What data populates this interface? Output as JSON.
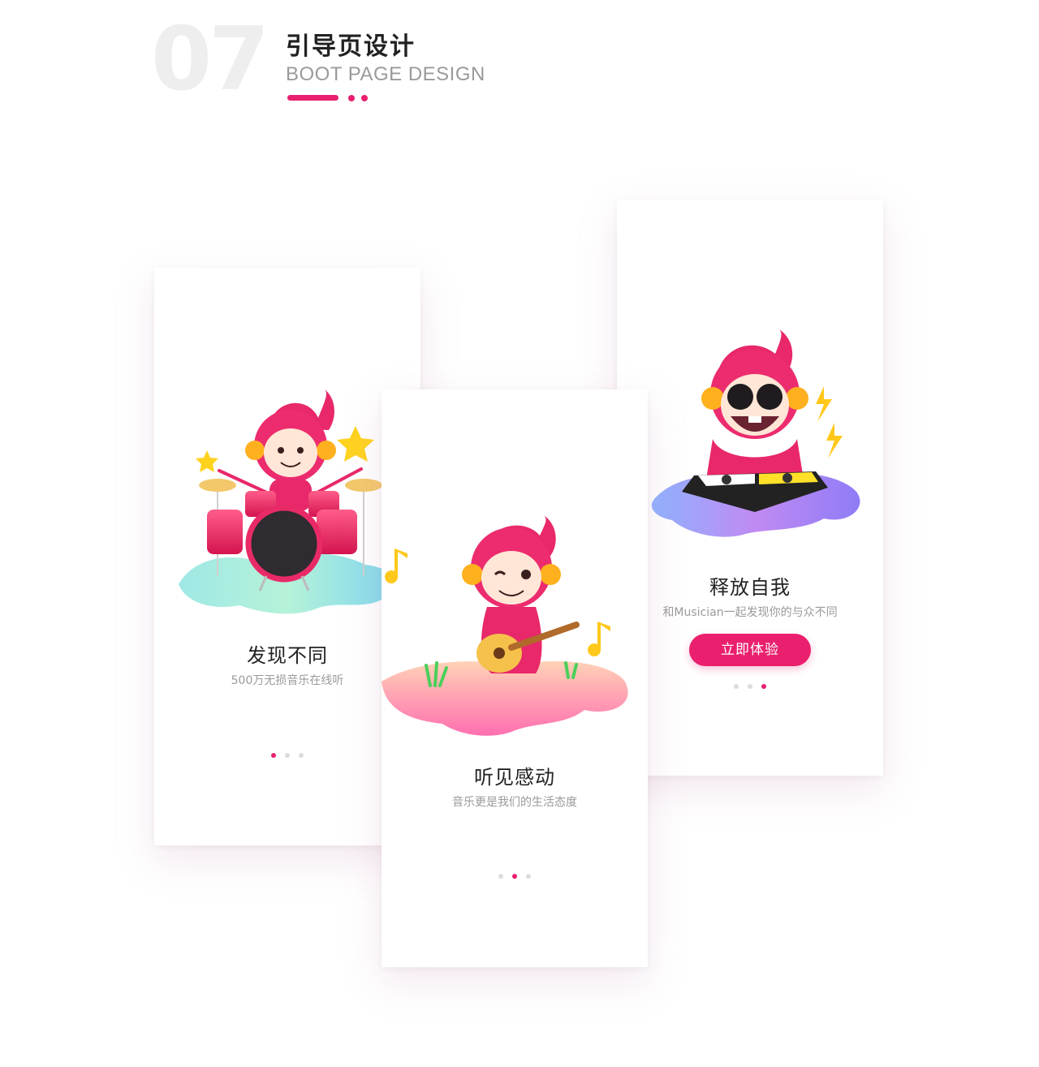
{
  "header": {
    "number": "07",
    "title_cn": "引导页设计",
    "title_en": "BOOT PAGE DESIGN",
    "accent_color": "#e8206f"
  },
  "screens": [
    {
      "title": "发现不同",
      "subtitle": "500万无损音乐在线听",
      "illustration": "drummer-mascot",
      "page_indicator": {
        "total": 3,
        "active": 1
      }
    },
    {
      "title": "听见感动",
      "subtitle": "音乐更是我们的生活态度",
      "illustration": "guitar-mascot",
      "page_indicator": {
        "total": 3,
        "active": 2
      }
    },
    {
      "title": "释放自我",
      "subtitle": "和Musician一起发现你的与众不同",
      "illustration": "dj-mascot",
      "button_label": "立即体验",
      "page_indicator": {
        "total": 3,
        "active": 3
      }
    }
  ],
  "colors": {
    "brand_pink": "#ea1f6e",
    "dot_inactive": "#dcdcdc",
    "title_text": "#222222",
    "subtitle_text": "#9a9a9a"
  }
}
